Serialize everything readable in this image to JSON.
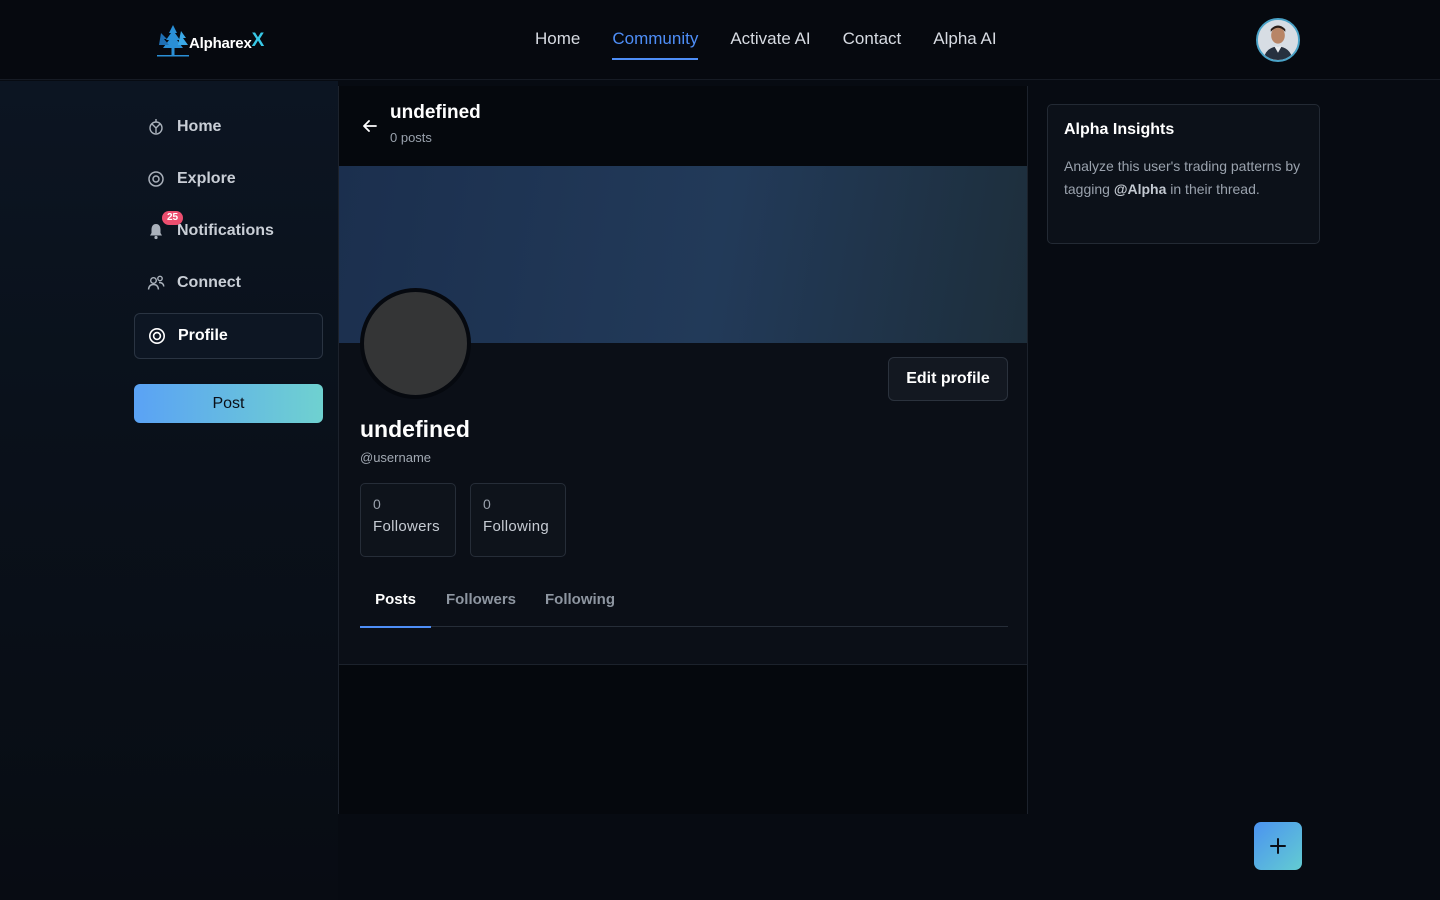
{
  "topnav": {
    "logo_text": "Alpharex",
    "logo_accent": "X",
    "items": [
      {
        "label": "Home",
        "active": false
      },
      {
        "label": "Community",
        "active": true
      },
      {
        "label": "Activate AI",
        "active": false
      },
      {
        "label": "Contact",
        "active": false
      },
      {
        "label": "Alpha AI",
        "active": false
      }
    ]
  },
  "sidebar": {
    "items": [
      {
        "label": "Home",
        "icon": "home-icon"
      },
      {
        "label": "Explore",
        "icon": "explore-icon"
      },
      {
        "label": "Notifications",
        "icon": "bell-icon",
        "badge": "25"
      },
      {
        "label": "Connect",
        "icon": "users-icon"
      },
      {
        "label": "Profile",
        "icon": "profile-icon",
        "active": true
      }
    ],
    "post_label": "Post"
  },
  "header": {
    "title": "undefined",
    "subtitle": "0 posts"
  },
  "profile": {
    "name": "undefined",
    "handle": "@username",
    "edit_label": "Edit profile",
    "followers_count": "0",
    "followers_label": "Followers",
    "following_count": "0",
    "following_label": "Following"
  },
  "tabs": [
    {
      "label": "Posts",
      "active": true
    },
    {
      "label": "Followers",
      "active": false
    },
    {
      "label": "Following",
      "active": false
    }
  ],
  "insights": {
    "title": "Alpha Insights",
    "text_before": "Analyze this user's trading patterns by tagging ",
    "mention": "@Alpha",
    "text_after": " in their thread."
  },
  "colors": {
    "accent": "#4e8ef7",
    "badge": "#ec4e6f",
    "gradient_start": "#5aa2f5",
    "gradient_end": "#6fd1d0"
  }
}
